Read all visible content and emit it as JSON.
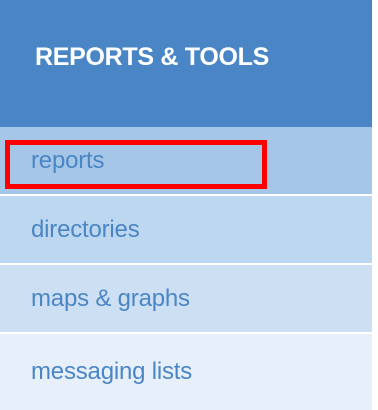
{
  "header": {
    "title": "REPORTS & TOOLS"
  },
  "menu": {
    "items": [
      {
        "label": "reports"
      },
      {
        "label": "directories"
      },
      {
        "label": "maps & graphs"
      },
      {
        "label": "messaging lists"
      }
    ]
  },
  "colors": {
    "header_bg": "#4a86c5",
    "link_text": "#4a86c5",
    "highlight": "#ff0000"
  }
}
